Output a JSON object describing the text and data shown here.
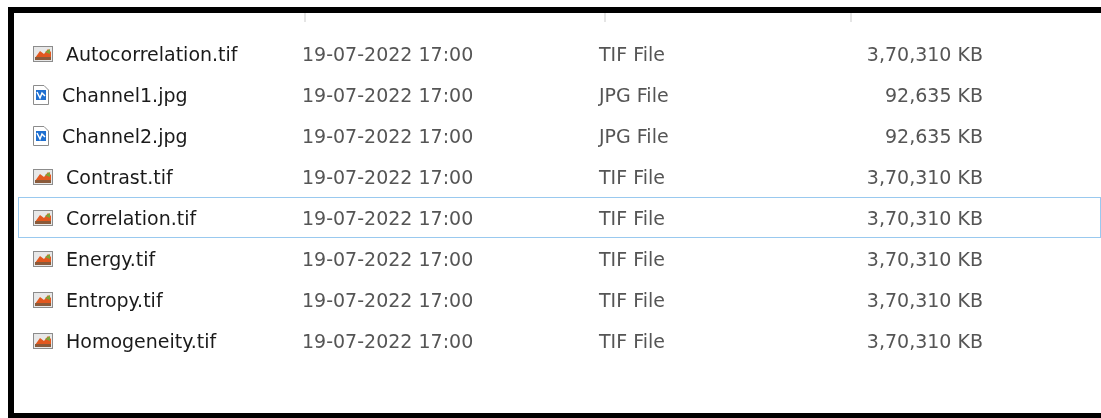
{
  "files": [
    {
      "name": "Autocorrelation.tif",
      "date": "19-07-2022 17:00",
      "type": "TIF File",
      "size": "3,70,310 KB",
      "kind": "tif",
      "focused": false
    },
    {
      "name": "Channel1.jpg",
      "date": "19-07-2022 17:00",
      "type": "JPG File",
      "size": "92,635 KB",
      "kind": "jpg",
      "focused": false
    },
    {
      "name": "Channel2.jpg",
      "date": "19-07-2022 17:00",
      "type": "JPG File",
      "size": "92,635 KB",
      "kind": "jpg",
      "focused": false
    },
    {
      "name": "Contrast.tif",
      "date": "19-07-2022 17:00",
      "type": "TIF File",
      "size": "3,70,310 KB",
      "kind": "tif",
      "focused": false
    },
    {
      "name": "Correlation.tif",
      "date": "19-07-2022 17:00",
      "type": "TIF File",
      "size": "3,70,310 KB",
      "kind": "tif",
      "focused": true
    },
    {
      "name": "Energy.tif",
      "date": "19-07-2022 17:00",
      "type": "TIF File",
      "size": "3,70,310 KB",
      "kind": "tif",
      "focused": false
    },
    {
      "name": "Entropy.tif",
      "date": "19-07-2022 17:00",
      "type": "TIF File",
      "size": "3,70,310 KB",
      "kind": "tif",
      "focused": false
    },
    {
      "name": "Homogeneity.tif",
      "date": "19-07-2022 17:00",
      "type": "TIF File",
      "size": "3,70,310 KB",
      "kind": "tif",
      "focused": false
    }
  ]
}
